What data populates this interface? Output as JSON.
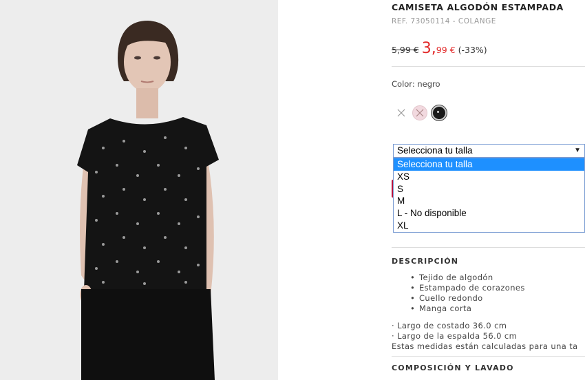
{
  "product": {
    "title": "CAMISETA ALGODÓN ESTAMPADA",
    "ref": "REF. 73050114 - COLANGE",
    "old_price": "5,99 €",
    "new_price_int": "3,",
    "new_price_dec": "99 €",
    "discount": "(-33%)",
    "color_label": "Color: negro",
    "swatches": [
      {
        "name": "white-swatch",
        "color": "#ffffff"
      },
      {
        "name": "pink-swatch",
        "color": "#f2d9df"
      },
      {
        "name": "black-swatch",
        "color": "#1a1a1a"
      }
    ],
    "accent_color": "#e22828"
  },
  "size_select": {
    "value": "Selecciona tu talla",
    "options": [
      "Selecciona tu talla",
      "XS",
      "S",
      "M",
      "L - No disponible",
      "XL"
    ],
    "selected_index": 0
  },
  "description": {
    "title": "DESCRIPCIÓN",
    "bullets": [
      "Tejido de algodón",
      "Estampado de corazones",
      "Cuello redondo",
      "Manga corta"
    ],
    "measures": [
      "· Largo de costado 36.0 cm",
      "· Largo de la espalda 56.0 cm",
      "Estas medidas están calculadas para una ta"
    ]
  },
  "composition": {
    "title": "COMPOSICIÓN Y LAVADO"
  }
}
